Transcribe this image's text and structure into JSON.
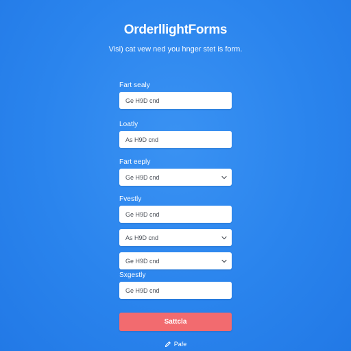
{
  "header": {
    "title": "OrderllightForms",
    "subtitle": "Visi) cat vew ned you hnger stet is form."
  },
  "form": {
    "fields": [
      {
        "label": "Fart sealy",
        "value": "Ge H9D cnd",
        "type": "text"
      },
      {
        "label": "Loatly",
        "value": "As H9D cnd",
        "type": "text"
      },
      {
        "label": "Fart eeply",
        "value": "Ge H9D cnd",
        "type": "select"
      },
      {
        "label": "Fvestly",
        "value": "Ge H9D cnd",
        "type": "text"
      },
      {
        "label": "",
        "value": "As H9D cnd",
        "type": "select"
      },
      {
        "label": "",
        "value": "Ge H9D cnd",
        "type": "select"
      },
      {
        "label": "Sxgestly",
        "value": "Ge H9D cnd",
        "type": "text"
      }
    ],
    "submit_label": "Sattcla"
  },
  "footer": {
    "link_text": "Pafe",
    "icon": "pencil-icon"
  },
  "colors": {
    "background": "#2b86ee",
    "submit": "#f26b6f",
    "field": "#ffffff"
  }
}
